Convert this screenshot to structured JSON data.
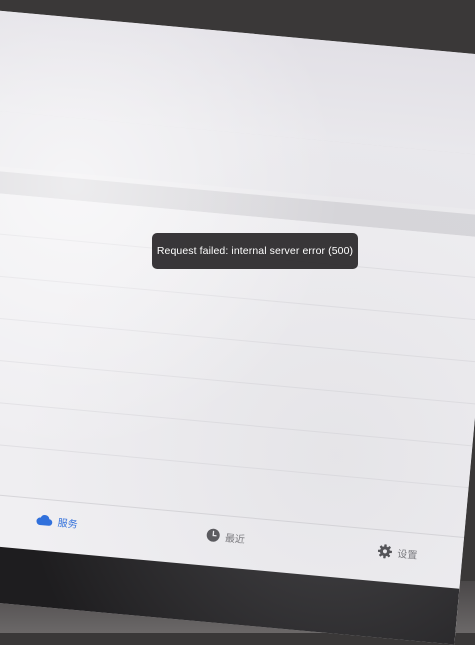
{
  "toast": {
    "message": "Request failed: internal server error (500)"
  },
  "tab_bar": {
    "active_color": "#2f6fdc",
    "tabs": [
      {
        "label": "服务",
        "icon": "cloud-icon",
        "active": true
      },
      {
        "label": "最近",
        "icon": "clock-icon",
        "active": false
      },
      {
        "label": "设置",
        "icon": "gear-icon",
        "active": false
      }
    ]
  }
}
